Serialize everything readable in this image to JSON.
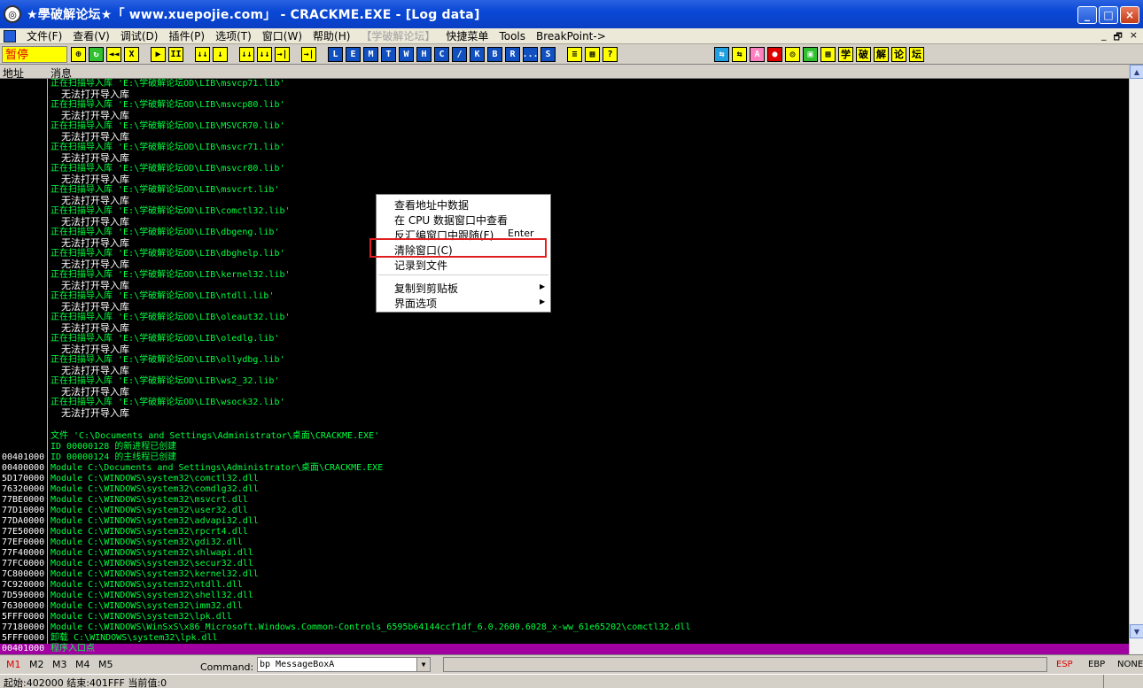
{
  "window": {
    "title": "★學破解论坛★「 www.xuepojie.com」 - CRACKME.EXE - [Log data]",
    "icon": "app-icon",
    "controls": [
      "_",
      "□",
      "×"
    ]
  },
  "menubar": {
    "items": [
      "文件(F)",
      "查看(V)",
      "调试(D)",
      "插件(P)",
      "选项(T)",
      "窗口(W)",
      "帮助(H)",
      "【学破解论坛】",
      "快捷菜单",
      "Tools",
      "BreakPoint->"
    ],
    "mdi_controls": [
      "_",
      "🗗",
      "×"
    ]
  },
  "toolbar": {
    "status": "暂停",
    "buttons_a": [
      "⊕",
      "↻",
      "◄◄",
      "X"
    ],
    "buttons_b": [
      "▶",
      "II"
    ],
    "buttons_c": [
      "↓↓",
      "↓",
      "↓↓",
      "↓↓",
      "→|"
    ],
    "buttons_d": [
      "→|"
    ],
    "letters": [
      "L",
      "E",
      "M",
      "T",
      "W",
      "H",
      "C",
      "/",
      "K",
      "B",
      "R",
      "...",
      "S"
    ],
    "buttons_e": [
      "≡",
      "▦",
      "?"
    ],
    "buttons_f": [
      "⇆",
      "⇆",
      "A",
      "●",
      "◎",
      "▣",
      "▦"
    ],
    "zh_buttons": [
      "学",
      "破",
      "解",
      "论",
      "坛"
    ]
  },
  "columns": {
    "address": "地址",
    "message": "消息"
  },
  "log": [
    {
      "addr": "",
      "msg": "正在扫描导入库 'E:\\学破解论坛OD\\LIB\\msvcp71.lib'",
      "style": "green"
    },
    {
      "addr": "",
      "msg": "无法打开导入库",
      "style": "white"
    },
    {
      "addr": "",
      "msg": "正在扫描导入库 'E:\\学破解论坛OD\\LIB\\msvcp80.lib'",
      "style": "green"
    },
    {
      "addr": "",
      "msg": "无法打开导入库",
      "style": "white"
    },
    {
      "addr": "",
      "msg": "正在扫描导入库 'E:\\学破解论坛OD\\LIB\\MSVCR70.lib'",
      "style": "green"
    },
    {
      "addr": "",
      "msg": "无法打开导入库",
      "style": "white"
    },
    {
      "addr": "",
      "msg": "正在扫描导入库 'E:\\学破解论坛OD\\LIB\\msvcr71.lib'",
      "style": "green"
    },
    {
      "addr": "",
      "msg": "无法打开导入库",
      "style": "white"
    },
    {
      "addr": "",
      "msg": "正在扫描导入库 'E:\\学破解论坛OD\\LIB\\msvcr80.lib'",
      "style": "green"
    },
    {
      "addr": "",
      "msg": "无法打开导入库",
      "style": "white"
    },
    {
      "addr": "",
      "msg": "正在扫描导入库 'E:\\学破解论坛OD\\LIB\\msvcrt.lib'",
      "style": "green"
    },
    {
      "addr": "",
      "msg": "无法打开导入库",
      "style": "white"
    },
    {
      "addr": "",
      "msg": "正在扫描导入库 'E:\\学破解论坛OD\\LIB\\comctl32.lib'",
      "style": "green"
    },
    {
      "addr": "",
      "msg": "无法打开导入库",
      "style": "white"
    },
    {
      "addr": "",
      "msg": "正在扫描导入库 'E:\\学破解论坛OD\\LIB\\dbgeng.lib'",
      "style": "green"
    },
    {
      "addr": "",
      "msg": "无法打开导入库",
      "style": "white"
    },
    {
      "addr": "",
      "msg": "正在扫描导入库 'E:\\学破解论坛OD\\LIB\\dbghelp.lib'",
      "style": "green"
    },
    {
      "addr": "",
      "msg": "无法打开导入库",
      "style": "white"
    },
    {
      "addr": "",
      "msg": "正在扫描导入库 'E:\\学破解论坛OD\\LIB\\kernel32.lib'",
      "style": "green"
    },
    {
      "addr": "",
      "msg": "无法打开导入库",
      "style": "white"
    },
    {
      "addr": "",
      "msg": "正在扫描导入库 'E:\\学破解论坛OD\\LIB\\ntdll.lib'",
      "style": "green"
    },
    {
      "addr": "",
      "msg": "无法打开导入库",
      "style": "white"
    },
    {
      "addr": "",
      "msg": "正在扫描导入库 'E:\\学破解论坛OD\\LIB\\oleaut32.lib'",
      "style": "green"
    },
    {
      "addr": "",
      "msg": "无法打开导入库",
      "style": "white"
    },
    {
      "addr": "",
      "msg": "正在扫描导入库 'E:\\学破解论坛OD\\LIB\\oledlg.lib'",
      "style": "green"
    },
    {
      "addr": "",
      "msg": "无法打开导入库",
      "style": "white"
    },
    {
      "addr": "",
      "msg": "正在扫描导入库 'E:\\学破解论坛OD\\LIB\\ollydbg.lib'",
      "style": "green"
    },
    {
      "addr": "",
      "msg": "无法打开导入库",
      "style": "white"
    },
    {
      "addr": "",
      "msg": "正在扫描导入库 'E:\\学破解论坛OD\\LIB\\ws2_32.lib'",
      "style": "green"
    },
    {
      "addr": "",
      "msg": "无法打开导入库",
      "style": "white"
    },
    {
      "addr": "",
      "msg": "正在扫描导入库 'E:\\学破解论坛OD\\LIB\\wsock32.lib'",
      "style": "green"
    },
    {
      "addr": "",
      "msg": "无法打开导入库",
      "style": "white"
    }
  ],
  "log2": [
    {
      "addr": "",
      "msg": "文件 'C:\\Documents and Settings\\Administrator\\桌面\\CRACKME.EXE'"
    },
    {
      "addr": "",
      "msg": "ID 00000128 的新进程已创建"
    },
    {
      "addr": "00401000",
      "msg": "ID 00000124 的主线程已创建"
    },
    {
      "addr": "00400000",
      "msg": "Module C:\\Documents and Settings\\Administrator\\桌面\\CRACKME.EXE"
    },
    {
      "addr": "5D170000",
      "msg": "Module C:\\WINDOWS\\system32\\comctl32.dll"
    },
    {
      "addr": "76320000",
      "msg": "Module C:\\WINDOWS\\system32\\comdlg32.dll"
    },
    {
      "addr": "77BE0000",
      "msg": "Module C:\\WINDOWS\\system32\\msvcrt.dll"
    },
    {
      "addr": "77D10000",
      "msg": "Module C:\\WINDOWS\\system32\\user32.dll"
    },
    {
      "addr": "77DA0000",
      "msg": "Module C:\\WINDOWS\\system32\\advapi32.dll"
    },
    {
      "addr": "77E50000",
      "msg": "Module C:\\WINDOWS\\system32\\rpcrt4.dll"
    },
    {
      "addr": "77EF0000",
      "msg": "Module C:\\WINDOWS\\system32\\gdi32.dll"
    },
    {
      "addr": "77F40000",
      "msg": "Module C:\\WINDOWS\\system32\\shlwapi.dll"
    },
    {
      "addr": "77FC0000",
      "msg": "Module C:\\WINDOWS\\system32\\secur32.dll"
    },
    {
      "addr": "7C800000",
      "msg": "Module C:\\WINDOWS\\system32\\kernel32.dll"
    },
    {
      "addr": "7C920000",
      "msg": "Module C:\\WINDOWS\\system32\\ntdll.dll"
    },
    {
      "addr": "7D590000",
      "msg": "Module C:\\WINDOWS\\system32\\shell32.dll"
    },
    {
      "addr": "76300000",
      "msg": "Module C:\\WINDOWS\\system32\\imm32.dll"
    },
    {
      "addr": "5FFF0000",
      "msg": "Module C:\\WINDOWS\\system32\\lpk.dll"
    },
    {
      "addr": "77180000",
      "msg": "Module C:\\WINDOWS\\WinSxS\\x86_Microsoft.Windows.Common-Controls_6595b64144ccf1df_6.0.2600.6028_x-ww_61e65202\\comctl32.dll"
    },
    {
      "addr": "5FFF0000",
      "msg": "卸载 C:\\WINDOWS\\system32\\lpk.dll"
    },
    {
      "addr": "00401000",
      "msg": "程序入口点",
      "selected": true
    }
  ],
  "context_menu": {
    "items": [
      {
        "label": "查看地址中数据"
      },
      {
        "label": "在 CPU 数据窗口中查看"
      },
      {
        "label": "反汇编窗口中跟随(F)",
        "shortcut": "Enter"
      },
      {
        "label": "清除窗口(C)",
        "highlighted": true
      },
      {
        "label": "记录到文件"
      },
      {
        "label": "复制到剪贴板",
        "submenu": true
      },
      {
        "label": "界面选项",
        "submenu": true
      }
    ]
  },
  "bottom": {
    "markers": [
      "M1",
      "M2",
      "M3",
      "M4",
      "M5"
    ],
    "command_label": "Command:",
    "command_value": "bp MessageBoxA",
    "registers": [
      "ESP",
      "EBP",
      "NONE"
    ]
  },
  "statusbar": {
    "text": "起始:402000 结束:401FFF 当前值:0"
  },
  "colors": {
    "log_green": "#00ff40",
    "log_white": "#ffffff",
    "log_bg": "#000000",
    "selected_row": "#a000a0",
    "highlight_box": "#e02020",
    "pause_bg": "#ffff00",
    "pause_fg": "#e00000"
  }
}
